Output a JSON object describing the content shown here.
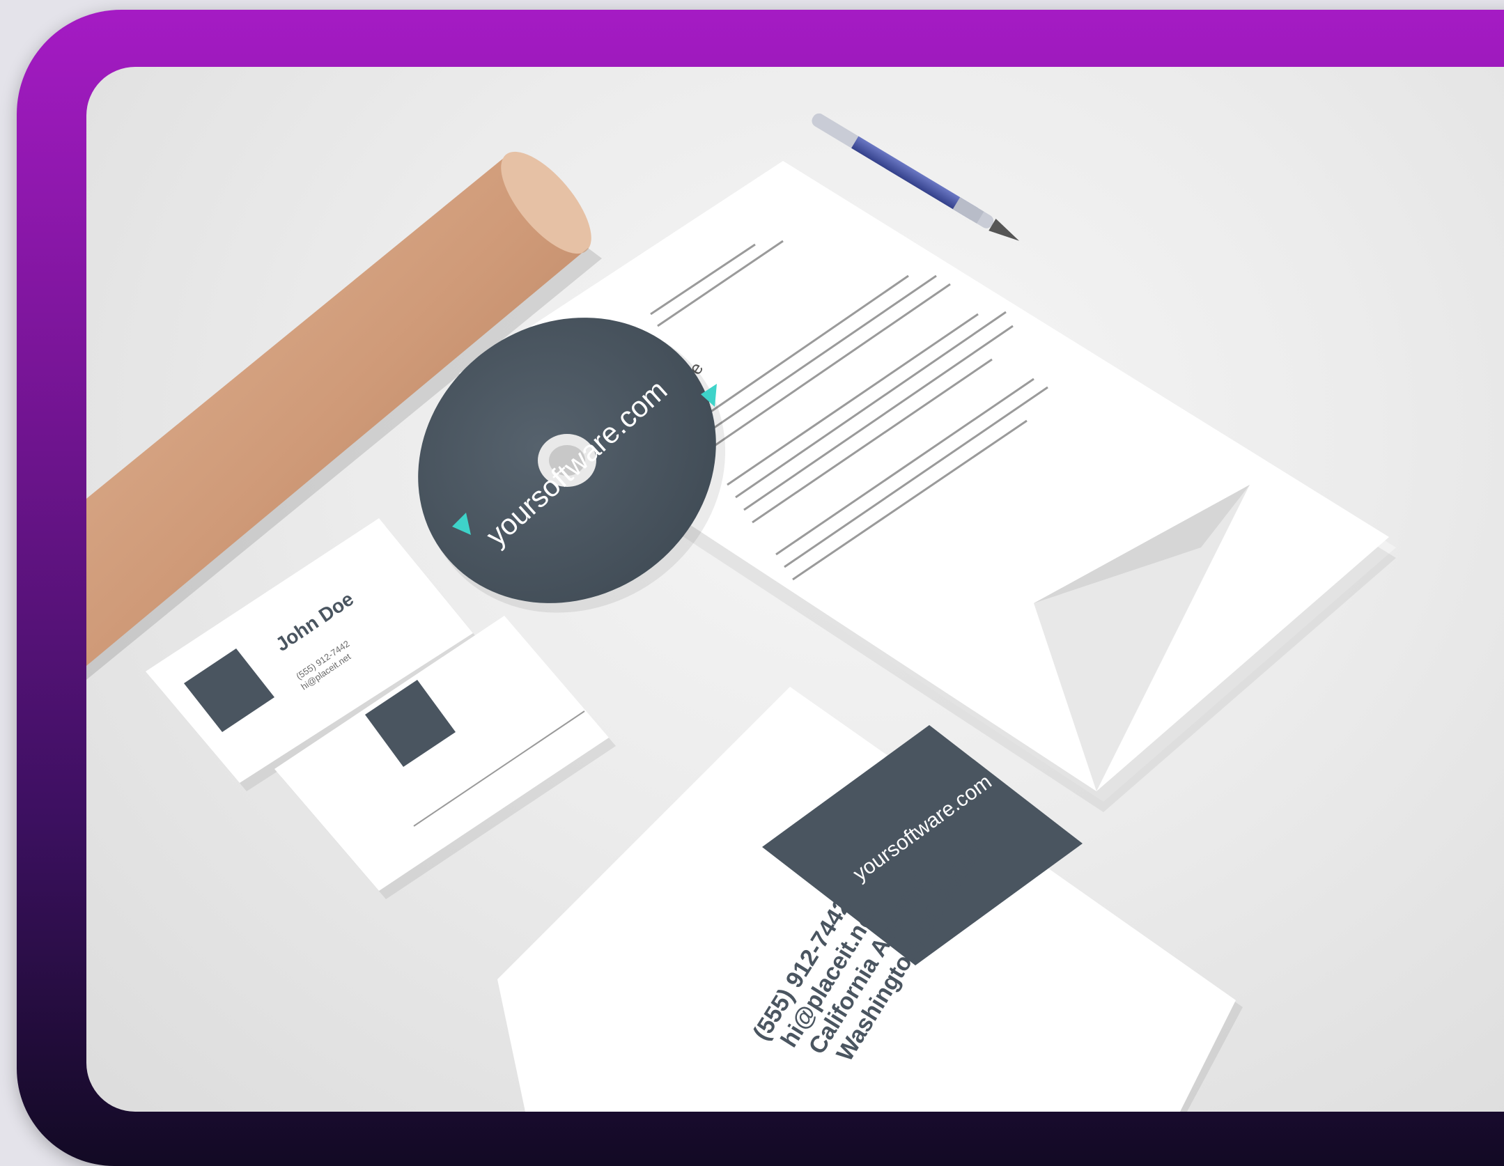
{
  "scene": {
    "colors": {
      "frame_top": "#a51bc4",
      "frame_bottom": "#120a24",
      "brand_dark": "#4a5560",
      "brand_accent": "#3ed3c9",
      "tube": "#cf9a78",
      "pen": "#4654a6"
    },
    "letterhead": {
      "greeting": "Dear Mr. Doe"
    },
    "cd": {
      "brand_text": "yoursoftware.com"
    },
    "business_card": {
      "name": "John Doe",
      "phone": "(555) 912-7442",
      "email": "hi@placeit.net"
    },
    "envelope": {
      "brand_text": "yoursoftware.com",
      "phone": "(555) 912-7442",
      "email": "hi@placeit.net",
      "address_1": "California Ave NW,",
      "address_2": "Washington, DC 20500"
    }
  }
}
